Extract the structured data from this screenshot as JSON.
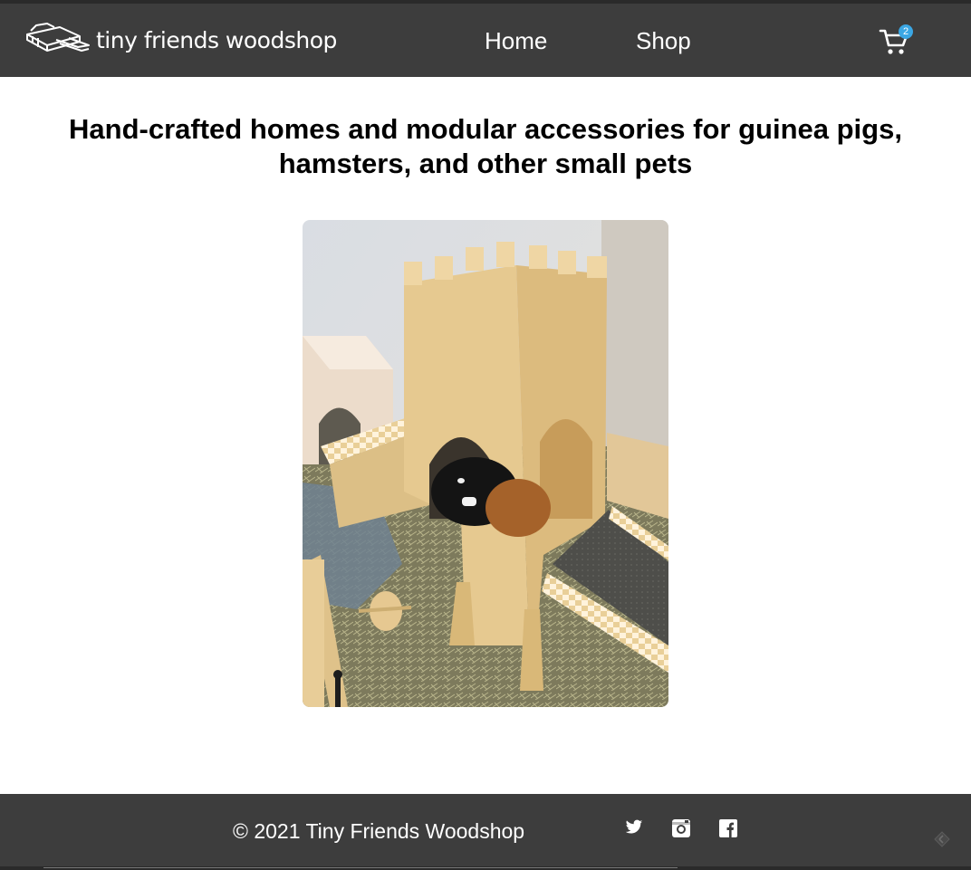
{
  "header": {
    "logo_text": "tiny friends woodshop",
    "logo_icon": "woodworking-plane-icon",
    "nav": [
      {
        "label": "Home"
      },
      {
        "label": "Shop"
      }
    ],
    "cart": {
      "icon": "cart-icon",
      "count": "2"
    }
  },
  "main": {
    "headline": "Hand-crafted homes and modular accessories for guinea pigs, hamsters, and other small pets",
    "hero_image": "photo of a guinea pig in a wooden castle tower inside a pet enclosure"
  },
  "footer": {
    "copyright": "© 2021 Tiny Friends Woodshop",
    "social": [
      {
        "icon": "twitter-icon"
      },
      {
        "icon": "instagram-icon"
      },
      {
        "icon": "facebook-icon"
      }
    ]
  },
  "colors": {
    "header_bg": "#3d3d3d",
    "footer_bg": "#3d3d3d",
    "badge": "#3ba7e4",
    "text_light": "#ffffff"
  }
}
